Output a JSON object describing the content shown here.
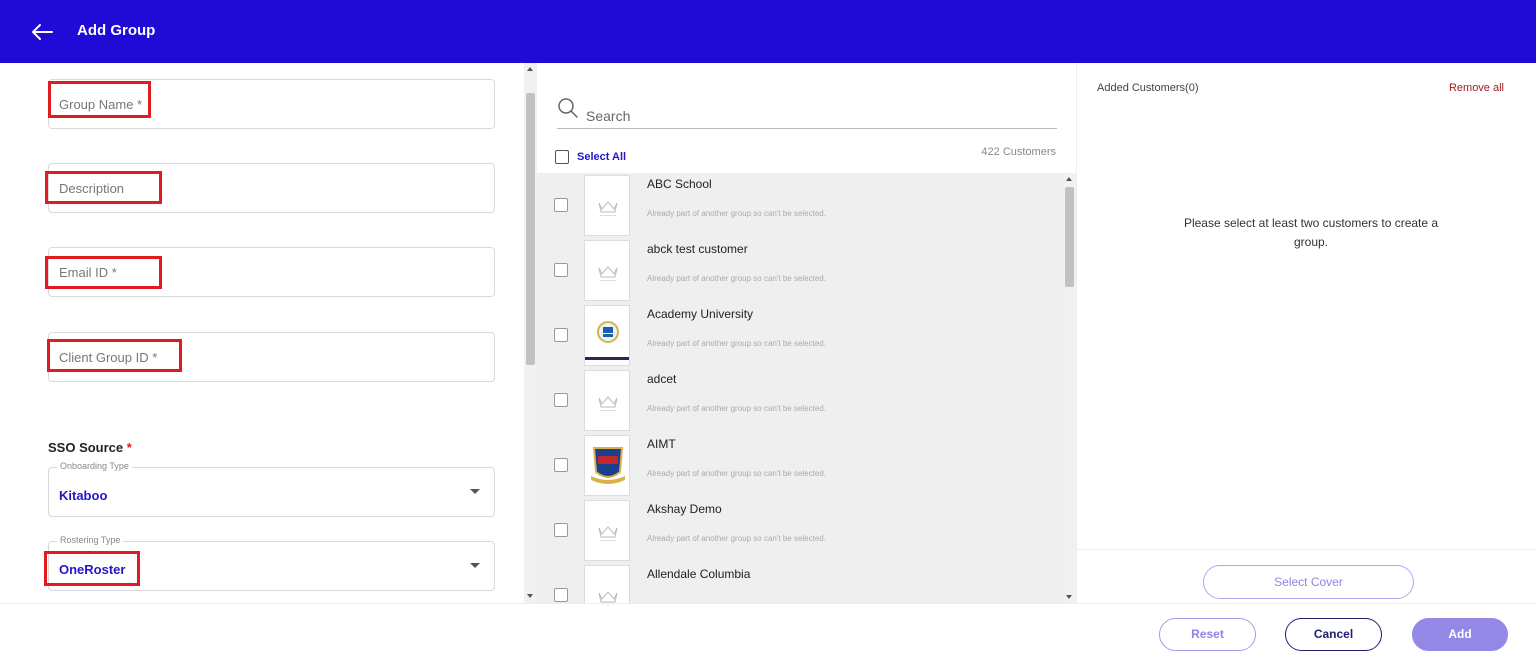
{
  "header": {
    "title": "Add Group",
    "back_icon": "arrow-left-icon"
  },
  "form": {
    "group_name_placeholder": "Group Name *",
    "description_placeholder": "Description",
    "email_placeholder": "Email ID *",
    "client_group_id_placeholder": "Client Group ID *",
    "sso_label": "SSO Source",
    "sso_required": "*",
    "onboarding_legend": "Onboarding Type",
    "onboarding_value": "Kitaboo",
    "rostering_legend": "Rostering Type",
    "rostering_value": "OneRoster"
  },
  "customers": {
    "search_placeholder": "Search",
    "select_all_label": "Select All",
    "count_label": "422 Customers",
    "items": [
      {
        "name": "ABC School",
        "note": "Already part of another group so can't be selected.",
        "logo": "placeholder"
      },
      {
        "name": "abck test customer",
        "note": "Already part of another group so can't be selected.",
        "logo": "placeholder"
      },
      {
        "name": "Academy University",
        "note": "Already part of another group so can't be selected.",
        "logo": "academy"
      },
      {
        "name": "adcet",
        "note": "Already part of another group so can't be selected.",
        "logo": "placeholder"
      },
      {
        "name": "AIMT",
        "note": "Already part of another group so can't be selected.",
        "logo": "aimt"
      },
      {
        "name": "Akshay Demo",
        "note": "Already part of another group so can't be selected.",
        "logo": "placeholder"
      },
      {
        "name": "Allendale Columbia",
        "note": "",
        "logo": "placeholder"
      }
    ]
  },
  "added": {
    "title": "Added Customers(0)",
    "remove_all": "Remove all",
    "empty_message": "Please select at least two customers to create a group.",
    "select_cover": "Select Cover"
  },
  "footer": {
    "reset": "Reset",
    "cancel": "Cancel",
    "add": "Add"
  },
  "colors": {
    "header": "#1f0ad6",
    "accent": "#2415c9",
    "highlight_box": "#e21b23"
  }
}
